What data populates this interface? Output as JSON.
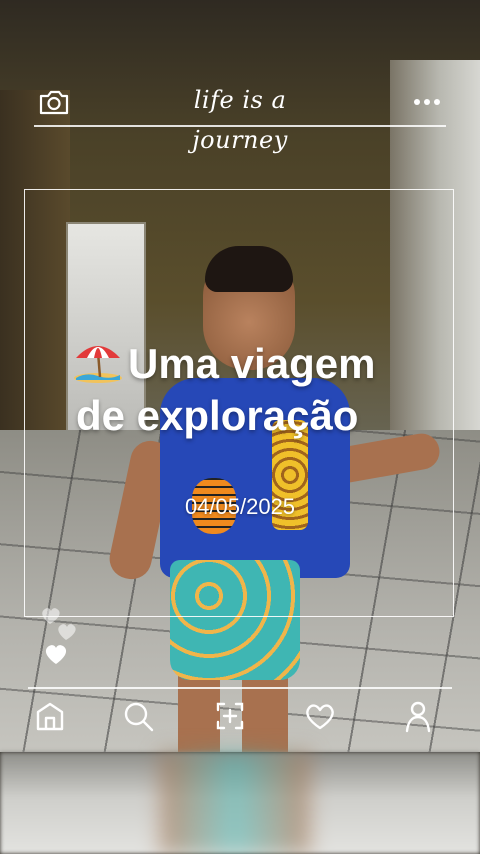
{
  "header": {
    "title": "life is a journey",
    "left_icon": "camera-icon",
    "right_icon": "more-dots-icon"
  },
  "card": {
    "emoji_icon": "beach-umbrella-icon",
    "headline_line1": "Uma viagem",
    "headline_line2": "de exploração",
    "date": "04/05/2025"
  },
  "side_widget": {
    "icon": "hearts-icon"
  },
  "bottom_nav": {
    "items": [
      {
        "icon": "home-icon"
      },
      {
        "icon": "search-icon"
      },
      {
        "icon": "add-post-icon"
      },
      {
        "icon": "heart-icon"
      },
      {
        "icon": "profile-icon"
      }
    ]
  },
  "colors": {
    "overlay_text": "#ffffff",
    "shirt": "#2648b7",
    "wall": "#5a4e2c"
  }
}
